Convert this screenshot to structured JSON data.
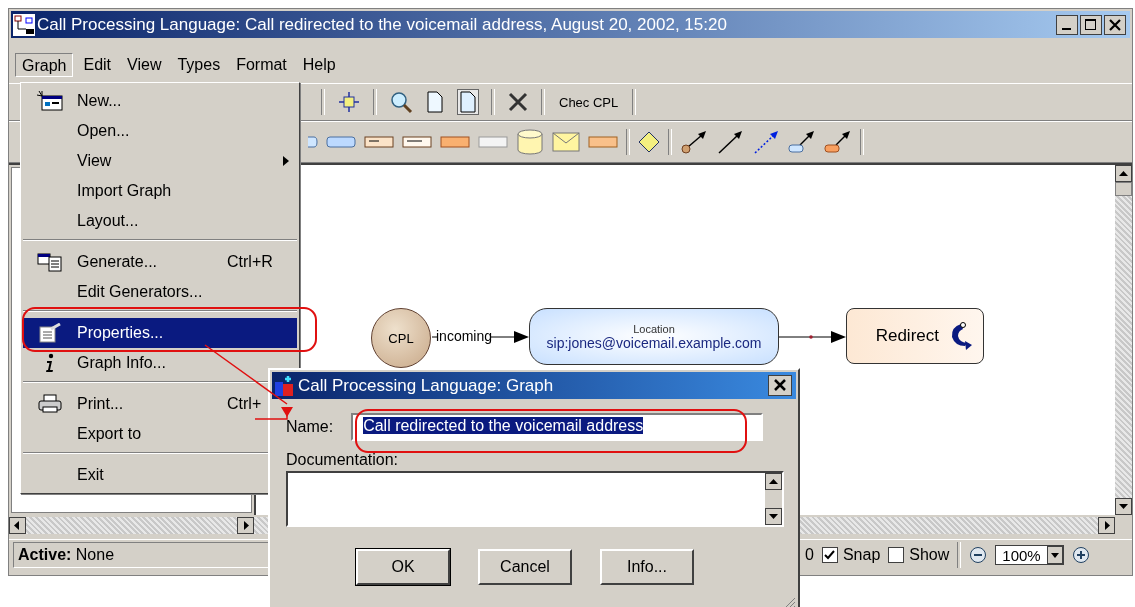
{
  "window": {
    "title": "Call Processing Language: Call redirected to the voicemail address, August 20, 2002, 15:20"
  },
  "menu_bar": [
    {
      "label": "Graph",
      "selected": true
    },
    {
      "label": "Edit",
      "selected": false
    },
    {
      "label": "View",
      "selected": false
    },
    {
      "label": "Types",
      "selected": false
    },
    {
      "label": "Format",
      "selected": false
    },
    {
      "label": "Help",
      "selected": false
    }
  ],
  "graph_menu": [
    {
      "kind": "item",
      "label": "New...",
      "selected": false
    },
    {
      "kind": "item",
      "label": "Open...",
      "selected": false
    },
    {
      "kind": "submenu",
      "label": "View",
      "selected": false
    },
    {
      "kind": "item",
      "label": "Import Graph",
      "selected": false
    },
    {
      "kind": "item",
      "label": "Layout...",
      "selected": false
    },
    {
      "kind": "separator"
    },
    {
      "kind": "item",
      "label": "Generate...",
      "shortcut": "Ctrl+R",
      "selected": false
    },
    {
      "kind": "item",
      "label": "Edit Generators...",
      "selected": false
    },
    {
      "kind": "separator"
    },
    {
      "kind": "item",
      "label": "Properties...",
      "selected": true
    },
    {
      "kind": "item",
      "label": "Graph Info...",
      "selected": false
    },
    {
      "kind": "separator"
    },
    {
      "kind": "item",
      "label": "Print...",
      "shortcut": "Ctrl+",
      "selected": false
    },
    {
      "kind": "item",
      "label": "Export to",
      "selected": false
    },
    {
      "kind": "separator"
    },
    {
      "kind": "item",
      "label": "Exit",
      "selected": false
    }
  ],
  "toolbar": {
    "check_button": "Chec CPL"
  },
  "diagram": {
    "nodes": [
      {
        "kind": "start",
        "label": "CPL"
      },
      {
        "kind": "location",
        "caption": "Location",
        "label": "sip:jones@voicemail.example.com"
      },
      {
        "kind": "redirect",
        "label": "Redirect"
      }
    ],
    "edge_label": "incoming"
  },
  "status_bar": {
    "active": "**Active:** None",
    "partial": "0",
    "snap": {
      "label": "Snap",
      "checked": true
    },
    "show": {
      "label": "Show",
      "checked": false
    },
    "zoom": "100%"
  },
  "dialog": {
    "title": "Call Processing Language: Graph",
    "name_label": "Name:",
    "name_value": "Call redirected to the voicemail address",
    "name_selected": true,
    "documentation_label": "Documentation:",
    "buttons": [
      {
        "label": "OK",
        "default": true
      },
      {
        "label": "Cancel",
        "default": false
      },
      {
        "label": "Info...",
        "default": false
      }
    ]
  }
}
